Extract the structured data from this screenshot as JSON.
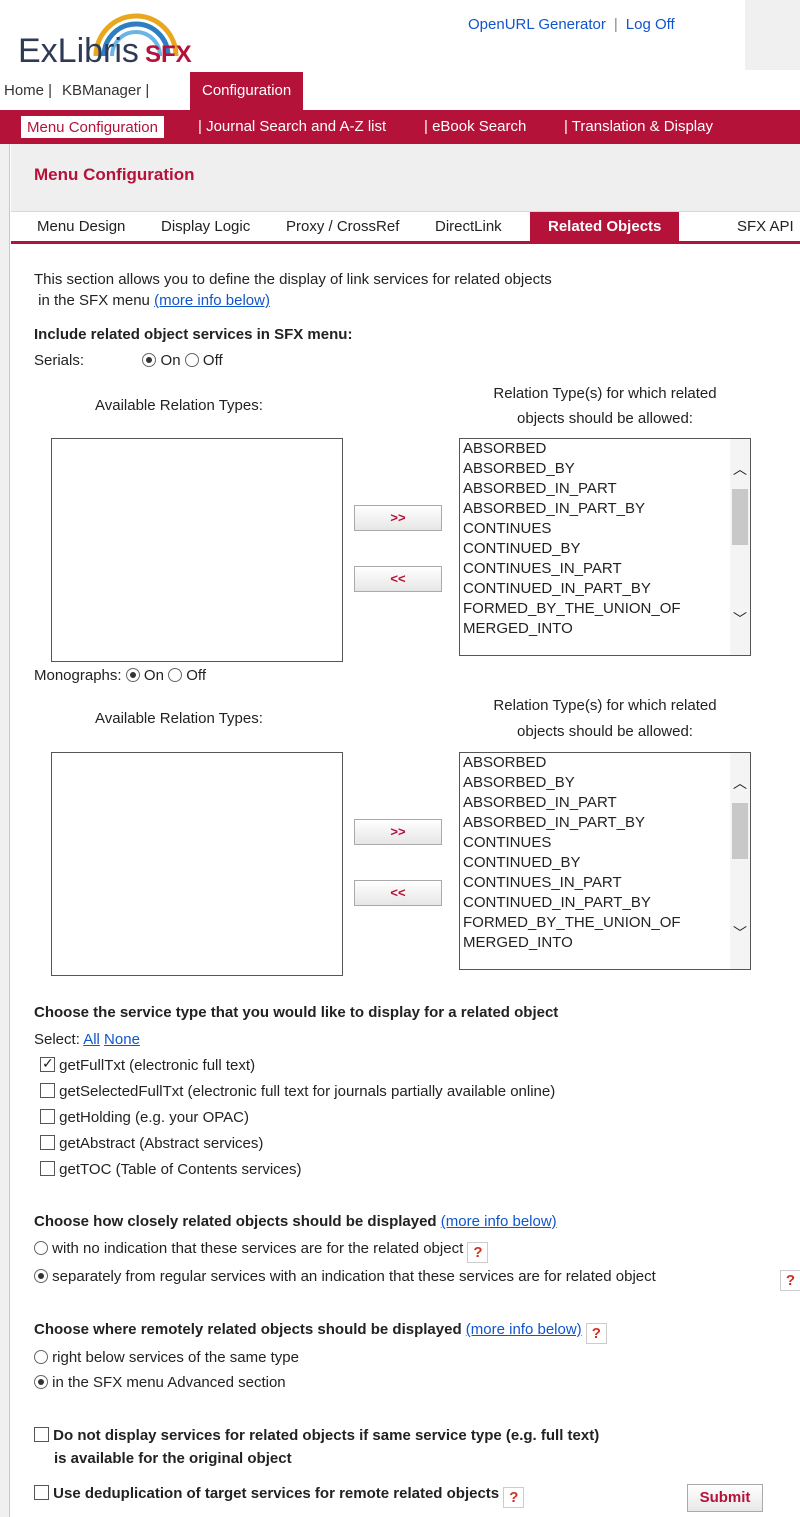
{
  "header": {
    "logo_brand": "ExLibris",
    "logo_product": "SFX",
    "openurl_generator": "OpenURL Generator",
    "separator": "|",
    "log_off": "Log Off"
  },
  "main_nav": {
    "home": "Home |",
    "kbmanager": "KBManager |",
    "configuration": "Configuration"
  },
  "sub_nav": {
    "menu_configuration": "Menu Configuration",
    "journal_search": "| Journal Search and A-Z list",
    "ebook_search": "| eBook Search",
    "translation_display": "| Translation & Display"
  },
  "page_title": "Menu Configuration",
  "tabs": {
    "menu_design": "Menu Design",
    "display_logic": "Display Logic",
    "proxy_crossref": "Proxy / CrossRef",
    "directlink": "DirectLink",
    "related_objects": "Related Objects",
    "sfx_api": "SFX API"
  },
  "intro": {
    "line1": "This section allows you to define the display of link services for related objects",
    "line2": " in the SFX menu",
    "more_info": "(more info below)"
  },
  "include_heading": "Include related object services in SFX menu:",
  "serials": {
    "label": "Serials:",
    "on": "On",
    "off": "Off",
    "available_label": "Available Relation Types:",
    "allowed_line1": "Relation Type(s) for which related",
    "allowed_line2": "objects should be allowed:",
    "move_right": ">>",
    "move_left": "<<",
    "selected": [
      "ABSORBED",
      "ABSORBED_BY",
      "ABSORBED_IN_PART",
      "ABSORBED_IN_PART_BY",
      "CONTINUES",
      "CONTINUED_BY",
      "CONTINUES_IN_PART",
      "CONTINUED_IN_PART_BY",
      "FORMED_BY_THE_UNION_OF",
      "MERGED_INTO"
    ]
  },
  "monographs": {
    "label": "Monographs:",
    "on": "On",
    "off": "Off",
    "available_label": "Available Relation Types:",
    "allowed_line1": "Relation Type(s) for which related",
    "allowed_line2": "objects should be allowed:",
    "move_right": ">>",
    "move_left": "<<",
    "selected": [
      "ABSORBED",
      "ABSORBED_BY",
      "ABSORBED_IN_PART",
      "ABSORBED_IN_PART_BY",
      "CONTINUES",
      "CONTINUED_BY",
      "CONTINUES_IN_PART",
      "CONTINUED_IN_PART_BY",
      "FORMED_BY_THE_UNION_OF",
      "MERGED_INTO"
    ]
  },
  "service_type": {
    "heading": "Choose the service type that you would like to display for a related object",
    "select_label": "Select:",
    "all": "All",
    "none": "None",
    "options": [
      {
        "label": "getFullTxt (electronic full text)",
        "checked": true
      },
      {
        "label": "getSelectedFullTxt (electronic full text for journals partially available online)",
        "checked": false
      },
      {
        "label": "getHolding (e.g. your OPAC)",
        "checked": false
      },
      {
        "label": "getAbstract (Abstract services)",
        "checked": false
      },
      {
        "label": "getTOC (Table of Contents services)",
        "checked": false
      }
    ]
  },
  "closeness": {
    "heading": "Choose how closely related objects should be displayed",
    "more_info": "(more info below)",
    "option1": "with no indication that these services are for the related object",
    "option2": "separately from regular services with an indication that these services are for related object",
    "help": "?"
  },
  "remote": {
    "heading": "Choose where remotely related objects should be displayed",
    "more_info": "(more info below)",
    "option1": "right below services of the same type",
    "option2": "in the SFX menu Advanced section",
    "help": "?"
  },
  "final_options": {
    "no_display_line1": "Do not display services for related objects if same service type (e.g. full text)",
    "no_display_line2": "is available for the original object",
    "dedup": "Use deduplication of target services for remote related objects",
    "help": "?",
    "submit": "Submit"
  },
  "colors": {
    "brand_red": "#b5123a",
    "link_blue": "#1155cc",
    "logo_navy": "#2f3b56"
  }
}
